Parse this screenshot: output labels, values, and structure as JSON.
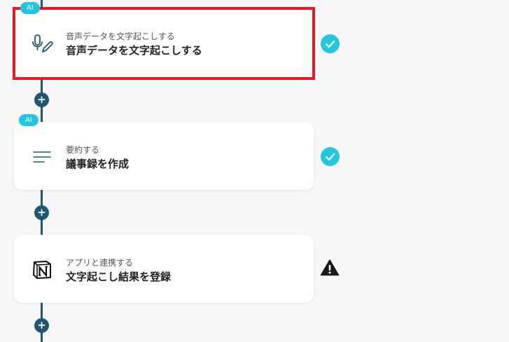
{
  "steps": [
    {
      "badge": "AI",
      "icon": "microphone-pen-icon",
      "subtitle": "音声データを文字起こしする",
      "title": "音声データを文字起こしする",
      "status": "completed",
      "selected": true
    },
    {
      "badge": "AI",
      "icon": "text-lines-icon",
      "subtitle": "要約する",
      "title": "議事録を作成",
      "status": "completed",
      "selected": false
    },
    {
      "badge": "",
      "icon": "notion-logo-icon",
      "subtitle": "アプリと連携する",
      "title": "文字起こし結果を登録",
      "status": "warning",
      "selected": false
    }
  ],
  "add_button_label": "+",
  "colors": {
    "flow_line": "#1f5670",
    "ai_badge": "#23c7dd",
    "selected_outline": "#e31b23",
    "check": "#23c7dd",
    "warning": "#1a1a1a"
  }
}
